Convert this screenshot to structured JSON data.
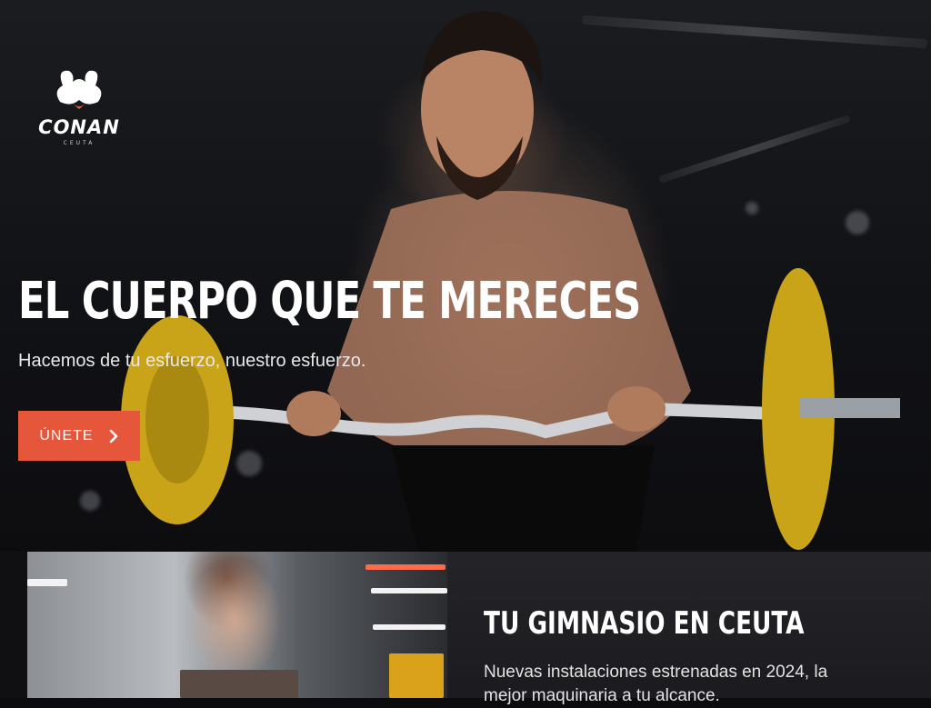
{
  "brand": {
    "name": "CONAN",
    "location": "CEUTA",
    "logo_icon": "flexing-arms-icon"
  },
  "hero": {
    "title": "EL CUERPO QUE TE MERECES",
    "subtitle": "Hacemos de tu esfuerzo, nuestro esfuerzo.",
    "cta_label": "ÚNETE",
    "cta_icon": "chevron-right-icon",
    "cta_color": "#e5563a"
  },
  "intro": {
    "title": "TU GIMNASIO EN CEUTA",
    "text": "Nuevas instalaciones estrenadas en 2024, la mejor maquinaria a tu alcance."
  }
}
